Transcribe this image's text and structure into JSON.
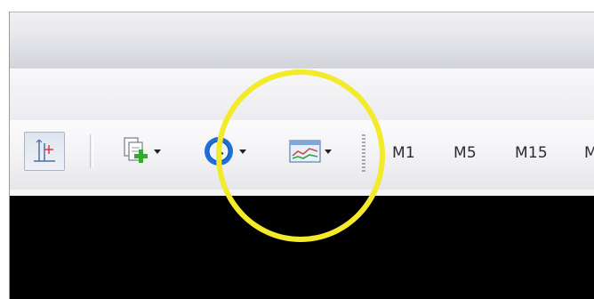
{
  "toolbar": {
    "crosshair_button": {
      "icon": "crosshair-icon",
      "pressed": true
    },
    "new_chart_button": {
      "icon": "new-chart-icon"
    },
    "history_button": {
      "icon": "history-icon"
    },
    "indicators_button": {
      "icon": "indicators-icon"
    },
    "timeframes": [
      "M1",
      "M5",
      "M15",
      "M"
    ]
  },
  "colors": {
    "chart_background": "#000000",
    "highlight_ring": "#f3ea2c",
    "add_plus": "#2fae2f",
    "history_blue": "#1f6fd6"
  }
}
